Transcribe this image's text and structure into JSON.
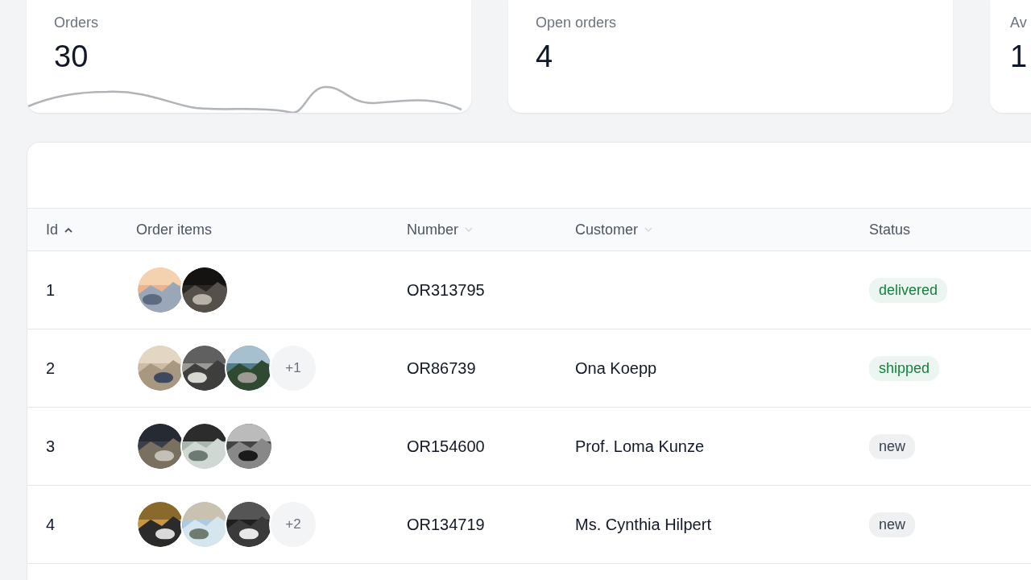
{
  "stats": [
    {
      "label": "Orders",
      "value": "30",
      "sparkline": true
    },
    {
      "label": "Open orders",
      "value": "4"
    },
    {
      "label": "Av",
      "value": "1"
    }
  ],
  "table": {
    "columns": [
      {
        "label": "Id",
        "sortable": true,
        "sorted": true
      },
      {
        "label": "Order items"
      },
      {
        "label": "Number",
        "sortable": true,
        "sorted": false
      },
      {
        "label": "Customer",
        "sortable": true,
        "sorted": false
      },
      {
        "label": "Status"
      }
    ],
    "rows": [
      {
        "id": "1",
        "number": "OR313795",
        "status": {
          "label": "delivered",
          "color": "#15803d"
        }
      },
      {
        "id": "2",
        "more": "+1",
        "number": "OR86739",
        "customer": "Ona Koepp",
        "status": {
          "label": "shipped",
          "color": "#15803d"
        }
      },
      {
        "id": "3",
        "number": "OR154600",
        "customer": "Prof. Loma Kunze",
        "status": {
          "label": "new",
          "color": "#374151"
        }
      },
      {
        "id": "4",
        "more": "+2",
        "number": "OR134719",
        "customer": "Ms. Cynthia Hilpert",
        "status": {
          "label": "new",
          "color": "#374151"
        }
      }
    ]
  }
}
